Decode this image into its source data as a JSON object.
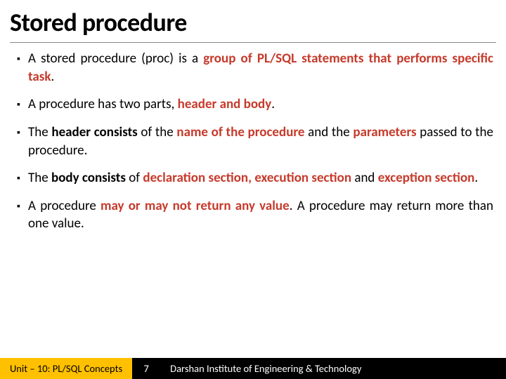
{
  "title": "Stored procedure",
  "bullets": [
    {
      "runs": [
        {
          "t": "A stored procedure (proc) is a ",
          "c": ""
        },
        {
          "t": "group of PL/SQL statements that performs specific task",
          "c": "accent"
        },
        {
          "t": ".",
          "c": ""
        }
      ]
    },
    {
      "runs": [
        {
          "t": "A procedure has two parts, ",
          "c": ""
        },
        {
          "t": "header and body",
          "c": "accent"
        },
        {
          "t": ".",
          "c": ""
        }
      ]
    },
    {
      "runs": [
        {
          "t": "The ",
          "c": ""
        },
        {
          "t": "header consists",
          "c": "bold"
        },
        {
          "t": " of the ",
          "c": ""
        },
        {
          "t": "name of the procedure",
          "c": "accent"
        },
        {
          "t": " and the ",
          "c": ""
        },
        {
          "t": "parameters",
          "c": "accent"
        },
        {
          "t": " passed to the procedure.",
          "c": ""
        }
      ]
    },
    {
      "runs": [
        {
          "t": "The ",
          "c": ""
        },
        {
          "t": "body consists",
          "c": "bold"
        },
        {
          "t": " of ",
          "c": ""
        },
        {
          "t": "declaration section, execution section",
          "c": "accent"
        },
        {
          "t": " and ",
          "c": ""
        },
        {
          "t": "exception section",
          "c": "accent"
        },
        {
          "t": ".",
          "c": ""
        }
      ]
    },
    {
      "runs": [
        {
          "t": "A procedure ",
          "c": ""
        },
        {
          "t": "may or may not return any value",
          "c": "accent"
        },
        {
          "t": ". A procedure may return more than one value.",
          "c": ""
        }
      ]
    }
  ],
  "footer": {
    "left": "Unit – 10: PL/SQL Concepts",
    "page": "7",
    "right": "Darshan Institute of Engineering & Technology"
  },
  "bullet_glyph": "▪"
}
